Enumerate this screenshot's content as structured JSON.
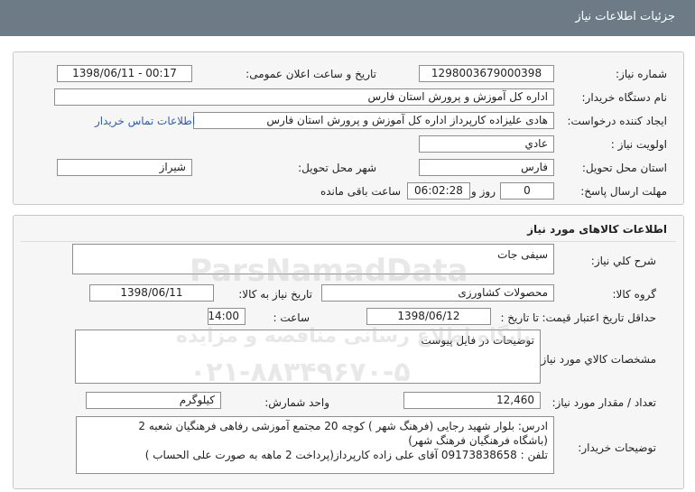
{
  "header": {
    "title": "جزئیات اطلاعات نیاز"
  },
  "info": {
    "need_number_label": "شماره نیاز:",
    "need_number": "1298003679000398",
    "announce_label": "تاریخ و ساعت اعلان عمومی:",
    "announce_value": "1398/06/11 - 00:17",
    "buyer_org_label": "نام دستگاه خریدار:",
    "buyer_org": "اداره کل آموزش و پرورش استان فارس",
    "creator_label": "ایجاد کننده درخواست:",
    "creator": "هادی علیزاده کارپرداز اداره کل آموزش و پرورش استان فارس",
    "contact_link": "اطلاعات تماس خریدار",
    "priority_label": "اولویت نیاز :",
    "priority": "عادي",
    "province_label": "استان محل تحویل:",
    "province": "فارس",
    "city_label": "شهر محل تحویل:",
    "city": "شیراز",
    "deadline_label": "مهلت ارسال پاسخ:",
    "days": "0",
    "day_and": "روز و",
    "time_left": "06:02:28",
    "time_left_suffix": "ساعت باقی مانده"
  },
  "goods": {
    "section_title": "اطلاعات کالاهای مورد نیاز",
    "desc_label": "شرح کلي نياز:",
    "desc": "سیفی جات",
    "group_label": "گروه کالا:",
    "group": "محصولات کشاورزی",
    "need_date_label": "تاریخ نیاز به کالا:",
    "need_date": "1398/06/11",
    "validity_label": "حداقل تاریخ اعتبار قیمت:",
    "until_date_label": "تا تاریخ :",
    "until_date": "1398/06/12",
    "hour_label": "ساعت :",
    "hour": "14:00",
    "specs_label": "مشخصات کالاي مورد نياز:",
    "specs": "توضیحات در فایل پیوست",
    "qty_label": "تعداد / مقدار مورد نیاز:",
    "qty": "12,460",
    "unit_label": "واحد شمارش:",
    "unit": "کیلوگرم",
    "buyer_notes_label": "توضیحات خریدار:",
    "buyer_notes_1": "ادرس: بلوار شهید رجایی (فرهنگ شهر ) کوچه 20  مجتمع آموزشی رفاهی فرهنگیان شعبه 2",
    "buyer_notes_2": "(باشگاه فرهنگیان فرهنگ شهر)",
    "buyer_notes_3": "تلفن : 09173838658 آقای علی زاده کارپرداز(پرداخت 2 ماهه به صورت علی الحساب )"
  },
  "watermark": {
    "brand": "ParsNamadData",
    "tagline": "پایگاه اطلاع رسانی مناقصه و مزایده",
    "phone": "۰۲۱-۸۸۳۴۹۶۷۰-۵"
  }
}
